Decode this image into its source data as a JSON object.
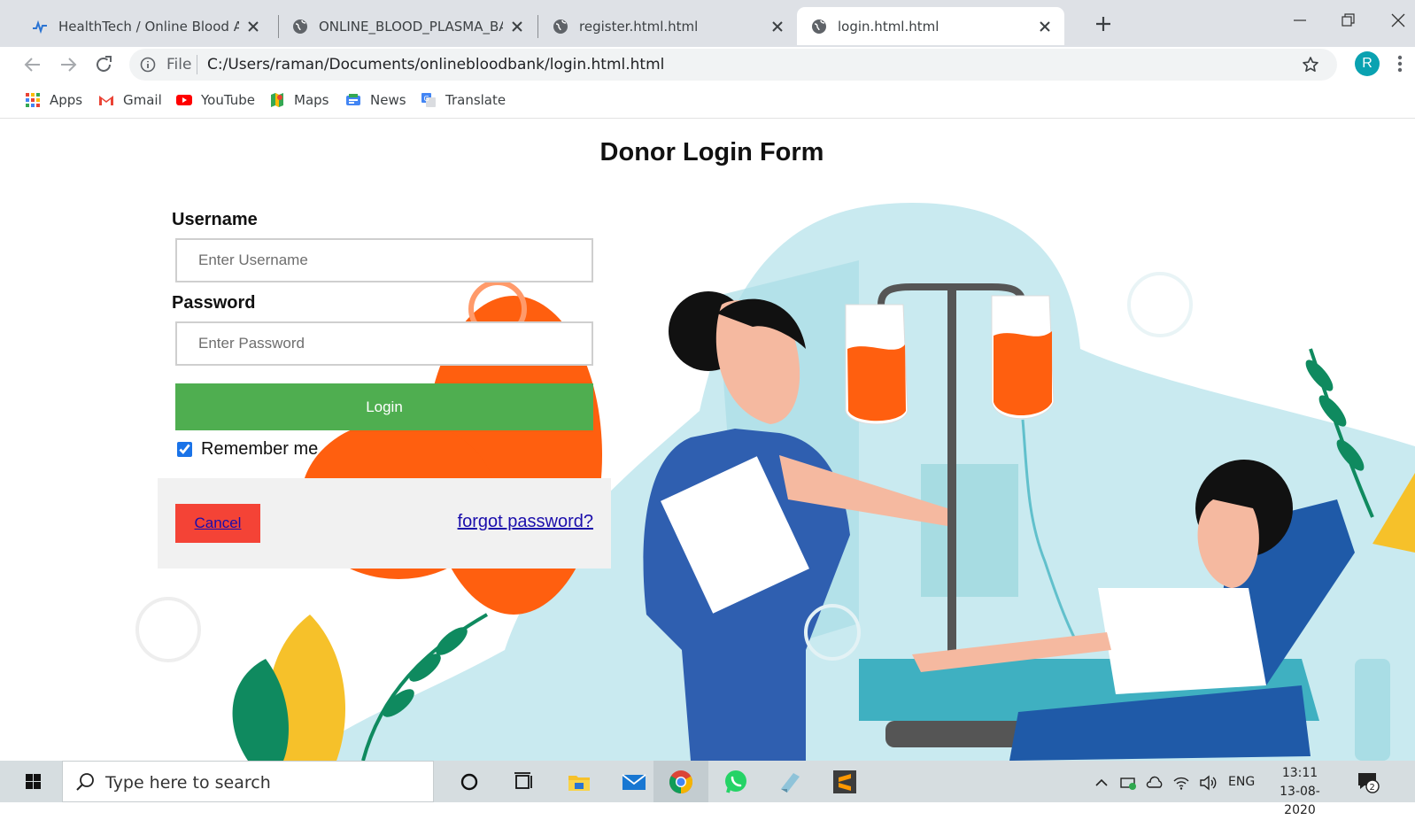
{
  "browser": {
    "tabs": [
      {
        "label": "HealthTech / Online Blood And P",
        "icon": "healthtech-favicon"
      },
      {
        "label": "ONLINE_BLOOD_PLASMA_BANK",
        "icon": "globe-icon"
      },
      {
        "label": "register.html.html",
        "icon": "globe-icon"
      },
      {
        "label": "login.html.html",
        "icon": "globe-icon",
        "active": true
      }
    ],
    "scheme": "File",
    "url": "C:/Users/raman/Documents/onlinebloodbank/login.html.html",
    "avatar_initial": "R",
    "bookmarks": [
      {
        "label": "Apps",
        "icon": "apps-grid-icon"
      },
      {
        "label": "Gmail",
        "icon": "gmail-icon"
      },
      {
        "label": "YouTube",
        "icon": "youtube-icon"
      },
      {
        "label": "Maps",
        "icon": "maps-icon"
      },
      {
        "label": "News",
        "icon": "news-icon"
      },
      {
        "label": "Translate",
        "icon": "translate-icon"
      }
    ]
  },
  "form": {
    "title": "Donor Login Form",
    "username_label": "Username",
    "username_placeholder": "Enter Username",
    "password_label": "Password",
    "password_placeholder": "Enter Password",
    "login_label": "Login",
    "remember_label": "Remember me",
    "remember_checked": true,
    "cancel_label": "Cancel",
    "forgot_label": "forgot password?"
  },
  "taskbar": {
    "search_placeholder": "Type here to search",
    "language": "ENG",
    "time": "13:11",
    "date": "13-08-2020",
    "notification_count": "2",
    "pinned": [
      "cortana-icon",
      "task-view-icon",
      "file-explorer-icon",
      "mail-icon",
      "chrome-icon",
      "whatsapp-icon",
      "app-icon",
      "sublime-text-icon"
    ]
  },
  "colors": {
    "login_button": "#4fae50",
    "cancel_button": "#f44336",
    "link": "#1a0dab",
    "accent_orange": "#ff5f0f",
    "teal_bg": "#c9eaf0"
  }
}
